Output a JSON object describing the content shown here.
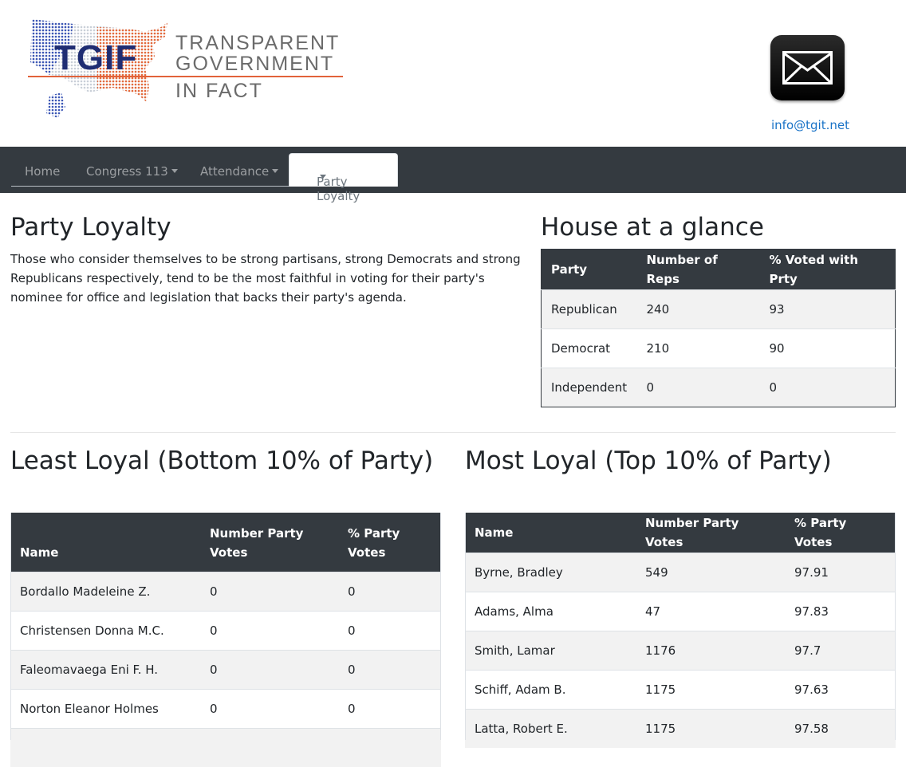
{
  "brand": {
    "abbr": "TGIF",
    "line1": "TRANSPARENT",
    "line2": "GOVERNMENT",
    "line3": "IN FACT"
  },
  "contact": {
    "email": "info@tgit.net",
    "icon": "envelope-icon"
  },
  "nav": {
    "home": "Home",
    "congress": "Congress 113",
    "attendance": "Attendance",
    "loyalty": "Party Loyalty"
  },
  "intro": {
    "title": "Party Loyalty",
    "text": "Those who consider themselves to be strong partisans, strong Democrats and strong Republicans respectively, tend to be the most faithful in voting for their party's nominee for office and legislation that backs their party's agenda."
  },
  "house": {
    "title": "House at a glance",
    "headers": [
      "Party",
      "Number of Reps",
      "% Voted with Prty"
    ],
    "rows": [
      [
        "Republican",
        "240",
        "93"
      ],
      [
        "Democrat",
        "210",
        "90"
      ],
      [
        "Independent",
        "0",
        "0"
      ]
    ]
  },
  "least": {
    "title": "Least Loyal (Bottom 10% of Party)",
    "headers": [
      "Name",
      "Number Party Votes",
      "% Party Votes"
    ],
    "rows": [
      [
        "Bordallo Madeleine Z.",
        "0",
        "0"
      ],
      [
        "Christensen Donna M.C.",
        "0",
        "0"
      ],
      [
        "Faleomavaega Eni F. H.",
        "0",
        "0"
      ],
      [
        "Norton Eleanor Holmes",
        "0",
        "0"
      ]
    ]
  },
  "most": {
    "title": "Most Loyal (Top 10% of Party)",
    "headers": [
      "Name",
      "Number Party Votes",
      "% Party Votes"
    ],
    "rows": [
      [
        "Byrne, Bradley",
        "549",
        "97.91"
      ],
      [
        "Adams, Alma",
        "47",
        "97.83"
      ],
      [
        "Smith, Lamar",
        "1176",
        "97.7"
      ],
      [
        "Schiff, Adam B.",
        "1175",
        "97.63"
      ],
      [
        "Latta, Robert E.",
        "1175",
        "97.58"
      ]
    ]
  }
}
